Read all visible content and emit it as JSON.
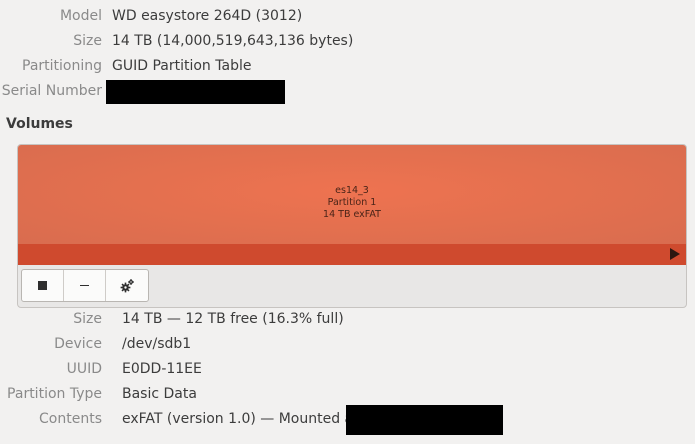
{
  "drive": {
    "model_label": "Model",
    "model_value": "WD easystore 264D (3012)",
    "size_label": "Size",
    "size_value": "14 TB (14,000,519,643,136 bytes)",
    "partitioning_label": "Partitioning",
    "partitioning_value": "GUID Partition Table",
    "serial_label": "Serial Number"
  },
  "volumes": {
    "title": "Volumes",
    "partition": {
      "name": "es14_3",
      "label": "Partition 1",
      "summary": "14 TB exFAT",
      "color": "#e8714f"
    },
    "toolbar": [
      {
        "icon": "stop-icon"
      },
      {
        "icon": "minus-icon"
      },
      {
        "icon": "gear-icon"
      }
    ]
  },
  "partition_details": {
    "size_label": "Size",
    "size_value": "14 TB — 12 TB free (16.3% full)",
    "device_label": "Device",
    "device_value": "/dev/sdb1",
    "uuid_label": "UUID",
    "uuid_value": "E0DD-11EE",
    "type_label": "Partition Type",
    "type_value": "Basic Data",
    "contents_label": "Contents",
    "contents_value": "exFAT (version 1.0) — Mounted at"
  }
}
